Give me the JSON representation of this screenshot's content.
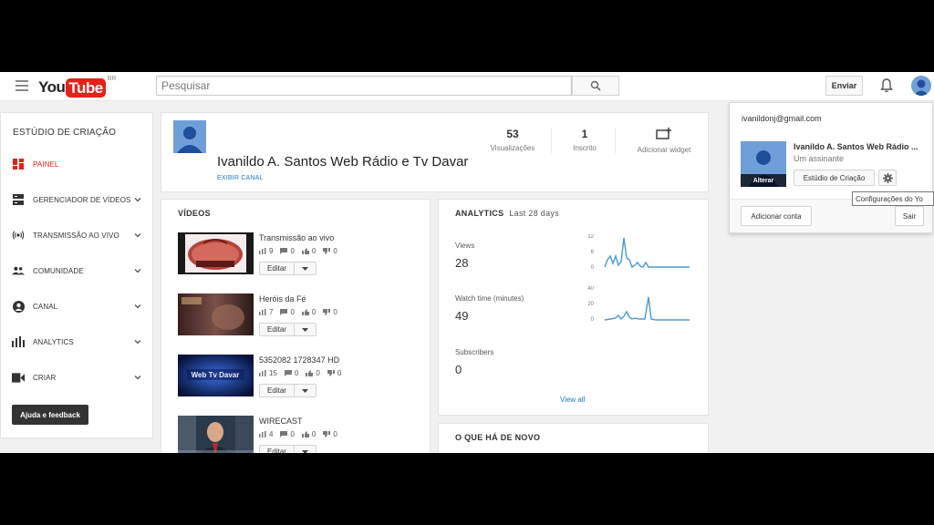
{
  "masthead": {
    "logo_you": "You",
    "logo_tube": "Tube",
    "logo_country": "BR",
    "search_placeholder": "Pesquisar",
    "upload_label": "Enviar"
  },
  "sidebar": {
    "title": "ESTÚDIO DE CRIAÇÃO",
    "items": [
      {
        "label": "PAINEL",
        "icon": "dashboard-icon",
        "active": true
      },
      {
        "label": "GERENCIADOR DE VÍDEOS",
        "icon": "video-manager-icon",
        "expandable": true
      },
      {
        "label": "TRANSMISSÃO AO VIVO",
        "icon": "live-broadcast-icon",
        "expandable": true
      },
      {
        "label": "COMUNIDADE",
        "icon": "community-icon",
        "expandable": true
      },
      {
        "label": "CANAL",
        "icon": "channel-icon",
        "expandable": true
      },
      {
        "label": "ANALYTICS",
        "icon": "analytics-icon",
        "expandable": true
      },
      {
        "label": "CRIAR",
        "icon": "camera-icon",
        "expandable": true
      }
    ],
    "help_label": "Ajuda e feedback"
  },
  "channel": {
    "name": "Ivanildo A. Santos Web Rádio e Tv Davar",
    "view_channel": "EXIBIR CANAL",
    "views_value": "53",
    "views_label": "Visualizações",
    "subs_value": "1",
    "subs_label": "Inscrito",
    "widget_label": "Adicionar widget"
  },
  "videos": {
    "title": "VÍDEOS",
    "edit_label": "Editar",
    "items": [
      {
        "title": "Transmissão ao vivo",
        "views": "9",
        "comments": "0",
        "likes": "0",
        "dislikes": "0",
        "thumb": "radio-davar-logo"
      },
      {
        "title": "Heróis da Fé",
        "views": "7",
        "comments": "0",
        "likes": "0",
        "dislikes": "0",
        "thumb": "herois-da-fe"
      },
      {
        "title": "5352082 1728347 HD",
        "views": "15",
        "comments": "0",
        "likes": "0",
        "dislikes": "0",
        "thumb": "web-tv-davar"
      },
      {
        "title": "WIRECAST",
        "views": "4",
        "comments": "0",
        "likes": "0",
        "dislikes": "0",
        "thumb": "wirecast-presenter"
      }
    ]
  },
  "analytics": {
    "title": "ANALYTICS",
    "period": "Last 28 days",
    "views_label": "Views",
    "views_value": "28",
    "views_ticks": [
      "12",
      "6",
      "0"
    ],
    "watch_label": "Watch time (minutes)",
    "watch_value": "49",
    "watch_ticks": [
      "40",
      "20",
      "0"
    ],
    "subs_label": "Subscribers",
    "subs_value": "0",
    "view_all": "View all",
    "line_color": "#4a9ad4"
  },
  "news": {
    "title": "O QUE HÁ DE NOVO"
  },
  "account": {
    "email": "ivanildonj@gmail.com",
    "name": "Ivanildo A. Santos Web Rádio ...",
    "subscribers": "Um assinante",
    "change_label": "Alterar",
    "studio_label": "Estúdio de Criação",
    "add_account": "Adicionar conta",
    "sign_out": "Sair",
    "tooltip": "Configurações do Yo"
  },
  "colors": {
    "accent_red": "#e62117",
    "link_blue": "#167ac6",
    "avatar_blue": "#6f9fd8"
  }
}
